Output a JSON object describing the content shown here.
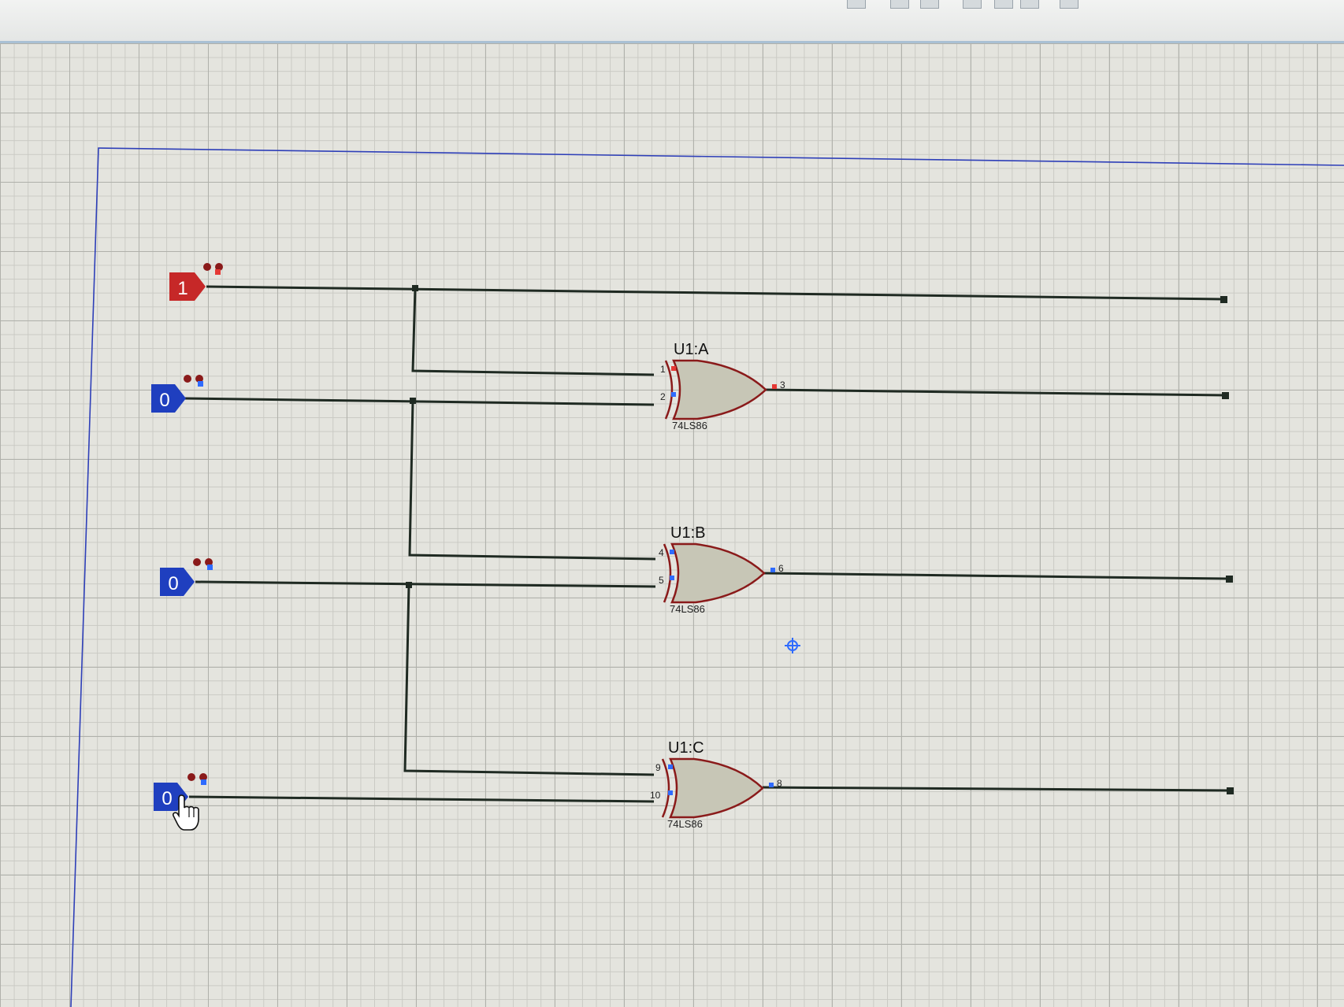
{
  "colors": {
    "wire": "#1f2a22",
    "gate_outline": "#8a1a1a",
    "gate_fill": "#c7c6b6",
    "logic_high": "#c62828",
    "logic_low": "#1f3fbf",
    "sheet_border": "#2e3fb8",
    "pin_high": "#e53935",
    "pin_low": "#2f6bff"
  },
  "inputs": [
    {
      "state": "1"
    },
    {
      "state": "0"
    },
    {
      "state": "0"
    },
    {
      "state": "0"
    }
  ],
  "gates": [
    {
      "name": "U1:A",
      "part": "74LS86",
      "pin_in1": "1",
      "pin_in2": "2",
      "pin_out": "3"
    },
    {
      "name": "U1:B",
      "part": "74LS86",
      "pin_in1": "4",
      "pin_in2": "5",
      "pin_out": "6"
    },
    {
      "name": "U1:C",
      "part": "74LS86",
      "pin_in1": "9",
      "pin_in2": "10",
      "pin_out": "8"
    }
  ],
  "icons": {
    "cursor": "hand-pointer-icon",
    "crosshair": "crosshair-icon"
  }
}
